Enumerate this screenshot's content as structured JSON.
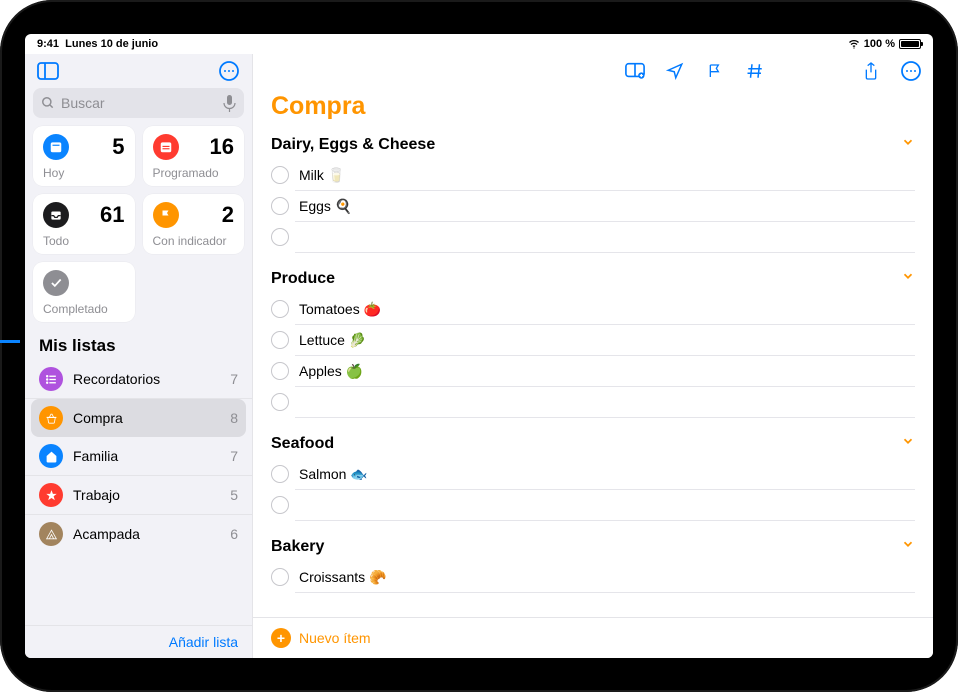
{
  "statusbar": {
    "time": "9:41",
    "date": "Lunes 10 de junio",
    "battery": "100 %"
  },
  "search": {
    "placeholder": "Buscar"
  },
  "smart": [
    {
      "id": "today",
      "label": "Hoy",
      "count": "5",
      "color": "blue",
      "icon": "calendar"
    },
    {
      "id": "scheduled",
      "label": "Programado",
      "count": "16",
      "color": "red",
      "icon": "calendar-list"
    },
    {
      "id": "all",
      "label": "Todo",
      "count": "61",
      "color": "dark",
      "icon": "tray"
    },
    {
      "id": "flagged",
      "label": "Con indicador",
      "count": "2",
      "color": "orange",
      "icon": "flag"
    },
    {
      "id": "completed",
      "label": "Completado",
      "count": "",
      "color": "gray",
      "icon": "check"
    }
  ],
  "sidebar": {
    "section_title": "Mis listas",
    "add_list": "Añadir lista",
    "lists": [
      {
        "name": "Recordatorios",
        "count": "7",
        "color": "purple",
        "icon": "list"
      },
      {
        "name": "Compra",
        "count": "8",
        "color": "orange",
        "icon": "basket",
        "selected": true
      },
      {
        "name": "Familia",
        "count": "7",
        "color": "blue",
        "icon": "home"
      },
      {
        "name": "Trabajo",
        "count": "5",
        "color": "starred",
        "icon": "star"
      },
      {
        "name": "Acampada",
        "count": "6",
        "color": "camp",
        "icon": "camp"
      }
    ]
  },
  "detail": {
    "title": "Compra",
    "new_item": "Nuevo ítem",
    "sections": [
      {
        "name": "Dairy, Eggs & Cheese",
        "items": [
          {
            "text": "Milk 🥛"
          },
          {
            "text": "Eggs 🍳"
          },
          {
            "text": ""
          }
        ]
      },
      {
        "name": "Produce",
        "items": [
          {
            "text": "Tomatoes 🍅"
          },
          {
            "text": "Lettuce 🥬"
          },
          {
            "text": "Apples 🍏"
          },
          {
            "text": ""
          }
        ]
      },
      {
        "name": "Seafood",
        "items": [
          {
            "text": "Salmon 🐟"
          },
          {
            "text": ""
          }
        ]
      },
      {
        "name": "Bakery",
        "items": [
          {
            "text": "Croissants 🥐"
          }
        ]
      }
    ]
  }
}
